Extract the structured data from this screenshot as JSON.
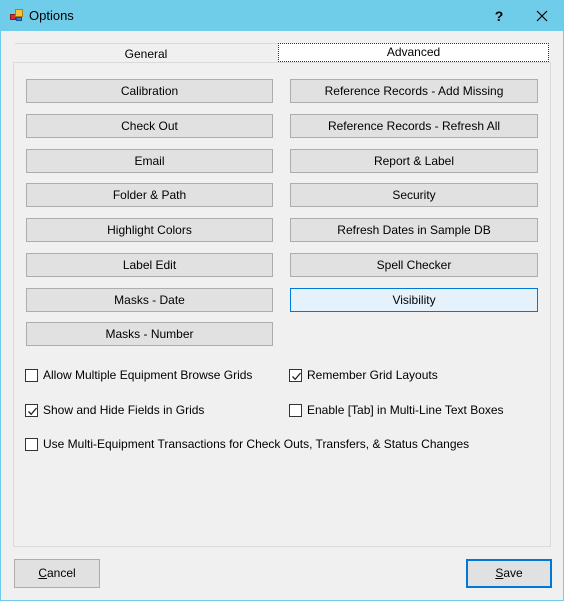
{
  "window": {
    "title": "Options",
    "help_label": "?",
    "icons": {
      "app": "app-icon",
      "help": "help-icon",
      "close": "close-icon"
    }
  },
  "tabs": [
    {
      "label": "General",
      "selected": false
    },
    {
      "label": "Advanced",
      "selected": true
    }
  ],
  "buttons_left": [
    {
      "label": "Calibration"
    },
    {
      "label": "Check Out"
    },
    {
      "label": "Email"
    },
    {
      "label": "Folder & Path"
    },
    {
      "label": "Highlight Colors"
    },
    {
      "label": "Label Edit"
    },
    {
      "label": "Masks - Date"
    },
    {
      "label": "Masks - Number"
    }
  ],
  "buttons_right": [
    {
      "label": "Reference Records - Add Missing"
    },
    {
      "label": "Reference Records - Refresh All"
    },
    {
      "label": "Report & Label"
    },
    {
      "label": "Security"
    },
    {
      "label": "Refresh Dates in Sample DB"
    },
    {
      "label": "Spell Checker"
    },
    {
      "label": "Visibility",
      "focused": true
    }
  ],
  "checkboxes": [
    {
      "label": "Allow Multiple Equipment Browse Grids",
      "checked": false
    },
    {
      "label": "Remember Grid Layouts",
      "checked": true
    },
    {
      "label": "Show and Hide Fields in Grids",
      "checked": true
    },
    {
      "label": "Enable [Tab] in Multi-Line Text Boxes",
      "checked": false
    },
    {
      "label": "Use Multi-Equipment Transactions for Check Outs, Transfers, & Status Changes",
      "checked": false
    }
  ],
  "footer": {
    "cancel": {
      "mnemonic": "C",
      "rest": "ancel"
    },
    "save": {
      "mnemonic": "S",
      "rest": "ave"
    }
  },
  "colors": {
    "titlebar": "#70cdea",
    "focus_border": "#0078d7",
    "focus_fill": "#e5f1fb",
    "button_fill": "#e1e1e1"
  }
}
